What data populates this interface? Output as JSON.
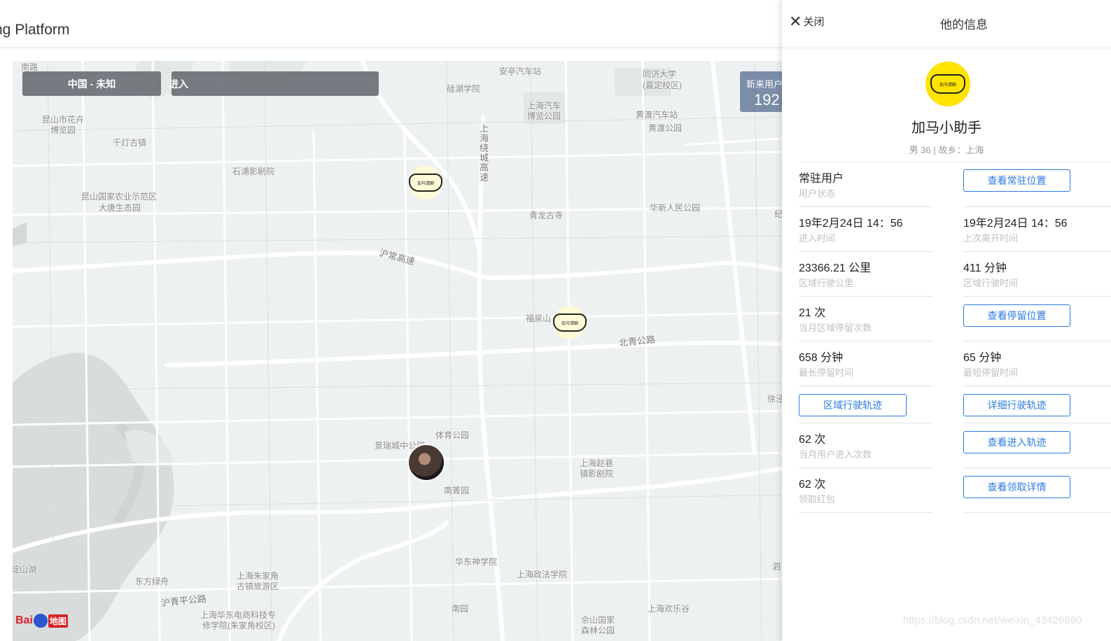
{
  "app": {
    "title": "ng Platform"
  },
  "map": {
    "overlay_region": "中国 - 未知",
    "overlay_enter": "进入",
    "stat_label": "新来用户",
    "stat_value": "192",
    "labels": {
      "nanlu": "南路",
      "anting_station": "安亭汽车站",
      "tongji": "同济大学",
      "jiading": "(嘉定校区)",
      "kunshan_huahui": "昆山市花卉",
      "bolanyuan": "博览园",
      "huhu_college": "硅湖学院",
      "shanghai_auto": "上海汽车",
      "auto_museum": "博览公园",
      "huangdu_station": "黄渡汽车站",
      "huangdu_park": "黄渡公园",
      "qiandeng": "千灯古镇",
      "ring": "上海绕城高速",
      "shipu": "石浦影剧院",
      "kunshan_agri": "昆山国家农业示范区",
      "datang": "大唐生态园",
      "qinglong": "青龙古寺",
      "huaxin": "华新人民公园",
      "huchang": "沪常高速",
      "fuquanshan": "福泉山",
      "beiqing": "北青公路",
      "xujing": "徐泾",
      "tiyu": "体育公园",
      "jingrui": "景瑞城中公园",
      "zhaoxiang": "上海赵巷",
      "zhaoxiang2": "镇影剧院",
      "nanjing_yuan": "南箐园",
      "dianshan": "淀山湖",
      "dongfang": "东方绿舟",
      "zhujiajiao": "上海朱家角",
      "zhujiajiao2": "古镇旅游区",
      "huadong_shen": "华东神学院",
      "zhengfa": "上海政法学院",
      "huqingping": "沪青平公路",
      "huadong_ec": "上海华东电商科技专",
      "huadong_ec2": "修学院(朱家角校区)",
      "nanyuan": "南园",
      "sheshan": "佘山国家",
      "sheshan2": "森林公园",
      "happy_valley": "上海欢乐谷",
      "si": "泗",
      "ji": "纪"
    },
    "baidu_text": "Bai",
    "baidu_map": "地图",
    "marker_logo_text": "加马请聊"
  },
  "panel": {
    "close_label": "关闭",
    "title": "他的信息",
    "name": "加马小助手",
    "meta": "男 36 | 故乡：上海",
    "rows": [
      {
        "left_val": "常驻用户",
        "left_lbl": "用户状态",
        "right_btn": "查看常驻位置"
      },
      {
        "left_val": "19年2月24日 14：56",
        "left_lbl": "进入时间",
        "right_val": "19年2月24日 14：56",
        "right_lbl": "上次离开时间"
      },
      {
        "left_val": "23366.21 公里",
        "left_lbl": "区域行驶公里",
        "right_val": "411 分钟",
        "right_lbl": "区域行驶时间"
      },
      {
        "left_val": "21 次",
        "left_lbl": "当月区域停留次数",
        "right_btn": "查看停留位置"
      },
      {
        "left_val": "658 分钟",
        "left_lbl": "最长停留时间",
        "right_val": "65 分钟",
        "right_lbl": "最短停留时间"
      },
      {
        "left_btn": "区域行驶轨迹",
        "right_btn": "详细行驶轨迹"
      },
      {
        "left_val": "62 次",
        "left_lbl": "当月用户进入次数",
        "right_btn": "查看进入轨迹"
      },
      {
        "left_val": "62 次",
        "left_lbl": "领取红包",
        "right_btn": "查看领取详情"
      }
    ]
  },
  "watermark": "https://blog.csdn.net/weixin_43426860"
}
